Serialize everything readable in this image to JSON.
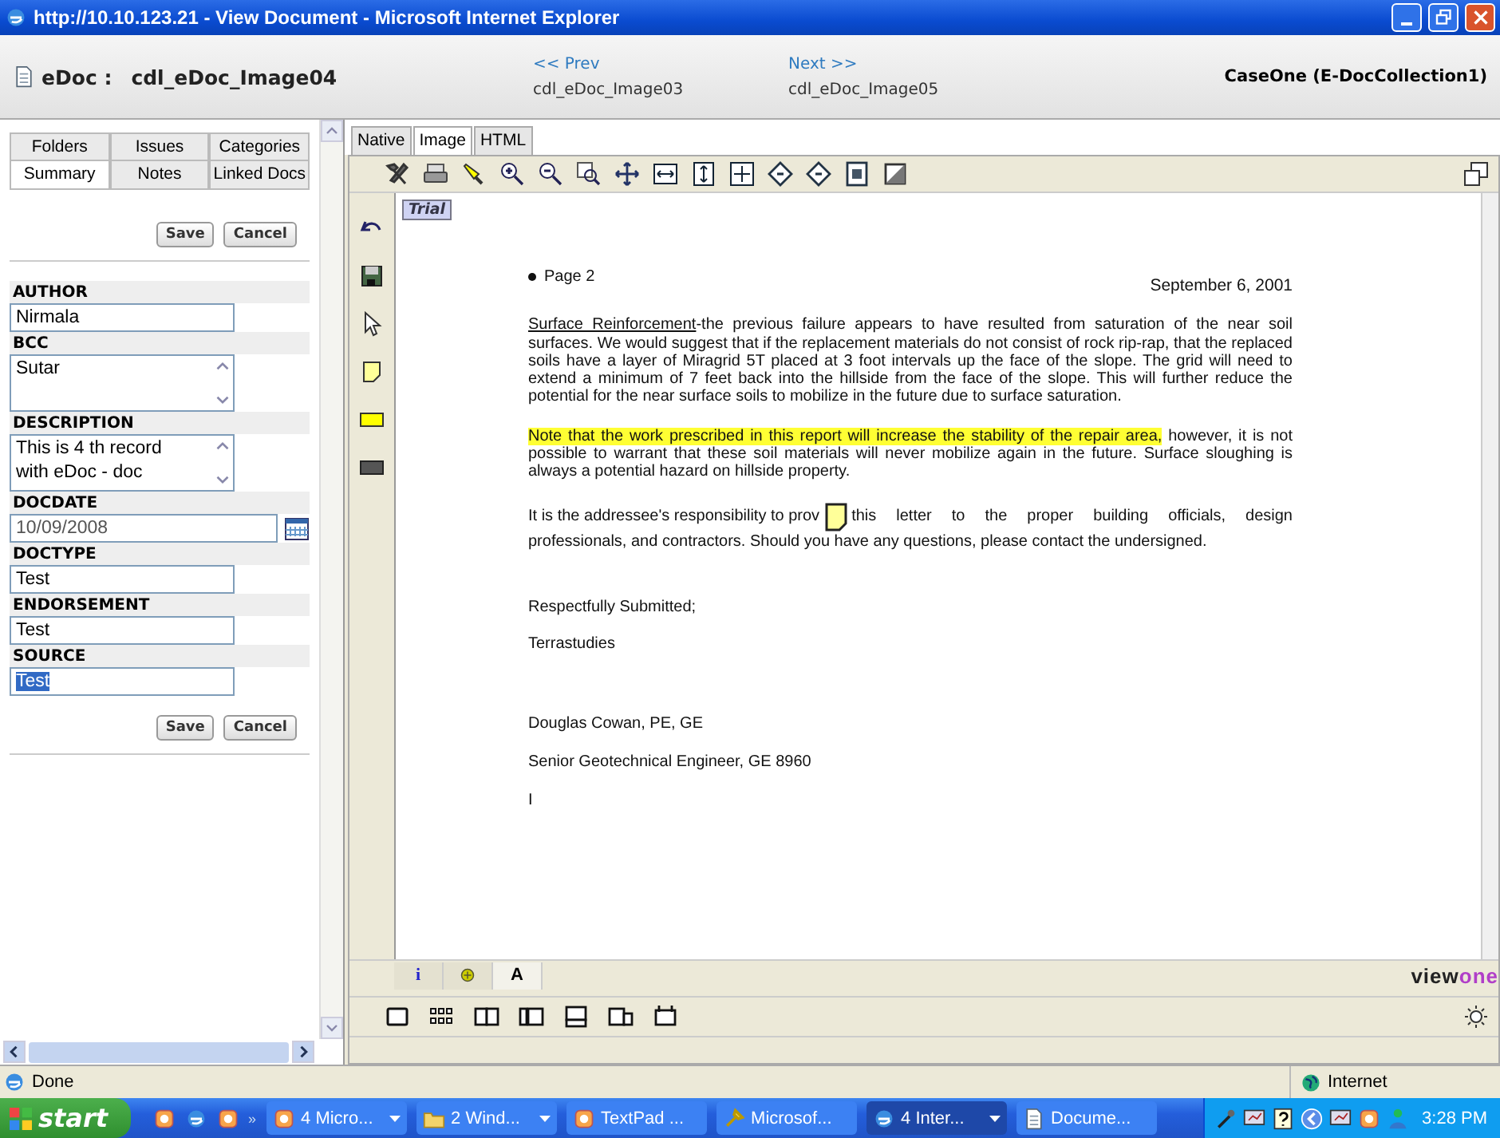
{
  "window": {
    "title": "http://10.10.123.21 - View Document - Microsoft Internet Explorer"
  },
  "header": {
    "label": "eDoc :",
    "doc_name": "cdl_eDoc_Image04",
    "prev": {
      "link": "<< Prev",
      "name": "cdl_eDoc_Image03"
    },
    "next": {
      "link": "Next >>",
      "name": "cdl_eDoc_Image05"
    },
    "collection": "CaseOne (E-DocCollection1)"
  },
  "side_tabs": [
    [
      {
        "label": "Folders",
        "selected": false
      },
      {
        "label": "Issues",
        "selected": false
      },
      {
        "label": "Categories",
        "selected": false
      }
    ],
    [
      {
        "label": "Summary",
        "selected": true
      },
      {
        "label": "Notes",
        "selected": false
      },
      {
        "label": "Linked Docs",
        "selected": false
      }
    ]
  ],
  "form": {
    "top_buttons": [
      "Save",
      "Cancel"
    ],
    "fields": [
      {
        "label": "AUTHOR",
        "kind": "text",
        "lines": [
          "Nirmala"
        ],
        "selected": false
      },
      {
        "label": "BCC",
        "kind": "textarea",
        "lines": [
          "Sutar"
        ],
        "selected": false
      },
      {
        "label": "DESCRIPTION",
        "kind": "textarea",
        "lines": [
          "This is 4 th  record",
          "with eDoc - doc"
        ],
        "selected": false
      },
      {
        "label": "DOCDATE",
        "kind": "date",
        "lines": [
          "10/09/2008"
        ],
        "selected": false
      },
      {
        "label": "DOCTYPE",
        "kind": "text",
        "lines": [
          "Test"
        ],
        "selected": false
      },
      {
        "label": "ENDORSEMENT",
        "kind": "text",
        "lines": [
          "Test"
        ],
        "selected": false
      },
      {
        "label": "SOURCE",
        "kind": "text",
        "lines": [
          "Test"
        ],
        "selected": true
      }
    ],
    "bottom_buttons": [
      "Save",
      "Cancel"
    ]
  },
  "viewer": {
    "tabs": [
      {
        "label": "Native",
        "selected": false
      },
      {
        "label": "Image",
        "selected": true
      },
      {
        "label": "HTML",
        "selected": false
      }
    ],
    "badge": "Trial",
    "document": {
      "page": "Page 2",
      "date": "September 6, 2001",
      "p1_lead": "Surface Reinforcement",
      "p1_rest": "-the previous failure appears to have resulted from saturation of the near soil surfaces.  We would suggest that if the replacement materials do not consist of rock rip-rap, that the replaced soils have a layer of Miragrid 5T placed at 3 foot intervals up the face of the slope.  The grid will need to extend a minimum of 7 feet back into the hillside from the face of the slope.  This will further reduce the potential for the near surface soils to mobilize in the future due to surface saturation.",
      "p2_highlight": "Note that the work prescribed in this report will increase the stability of the repair area,",
      "p2_rest": " however, it is not possible to warrant that these soil materials will never mobilize again in the future.  Surface sloughing is always a potential hazard on hillside property.",
      "p3_before": "It is the addressee's responsibility to prov",
      "p3_after": "this letter to the proper building officials, design",
      "p3_last": "professionals, and contractors.  Should you have any questions, please contact the undersigned.",
      "closing": [
        "Respectfully Submitted;",
        "Terrastudies"
      ],
      "signature": [
        "Douglas Cowan, PE, GE",
        "Senior Geotechnical Engineer, GE 8960",
        "I"
      ]
    },
    "bottom_tabs": [
      {
        "kind": "text",
        "label": "i",
        "selected": false
      },
      {
        "kind": "icon",
        "selected": false
      },
      {
        "kind": "text",
        "label": "A",
        "selected": true
      }
    ],
    "logo": {
      "first": "view",
      "second": "one"
    }
  },
  "status_bar": {
    "text": "Done",
    "zone": "Internet"
  },
  "taskbar": {
    "start": "start",
    "overflow": "»",
    "items": [
      {
        "label": "4 Micro...",
        "selected": false,
        "grouped": true
      },
      {
        "label": "2 Wind...",
        "selected": false,
        "grouped": true
      },
      {
        "label": "TextPad ...",
        "selected": false,
        "grouped": false
      },
      {
        "label": "Microsof...",
        "selected": false,
        "grouped": false
      },
      {
        "label": "4 Inter...",
        "selected": true,
        "grouped": true
      },
      {
        "label": "Docume...",
        "selected": false,
        "grouped": false
      }
    ],
    "clock": "3:28 PM"
  }
}
